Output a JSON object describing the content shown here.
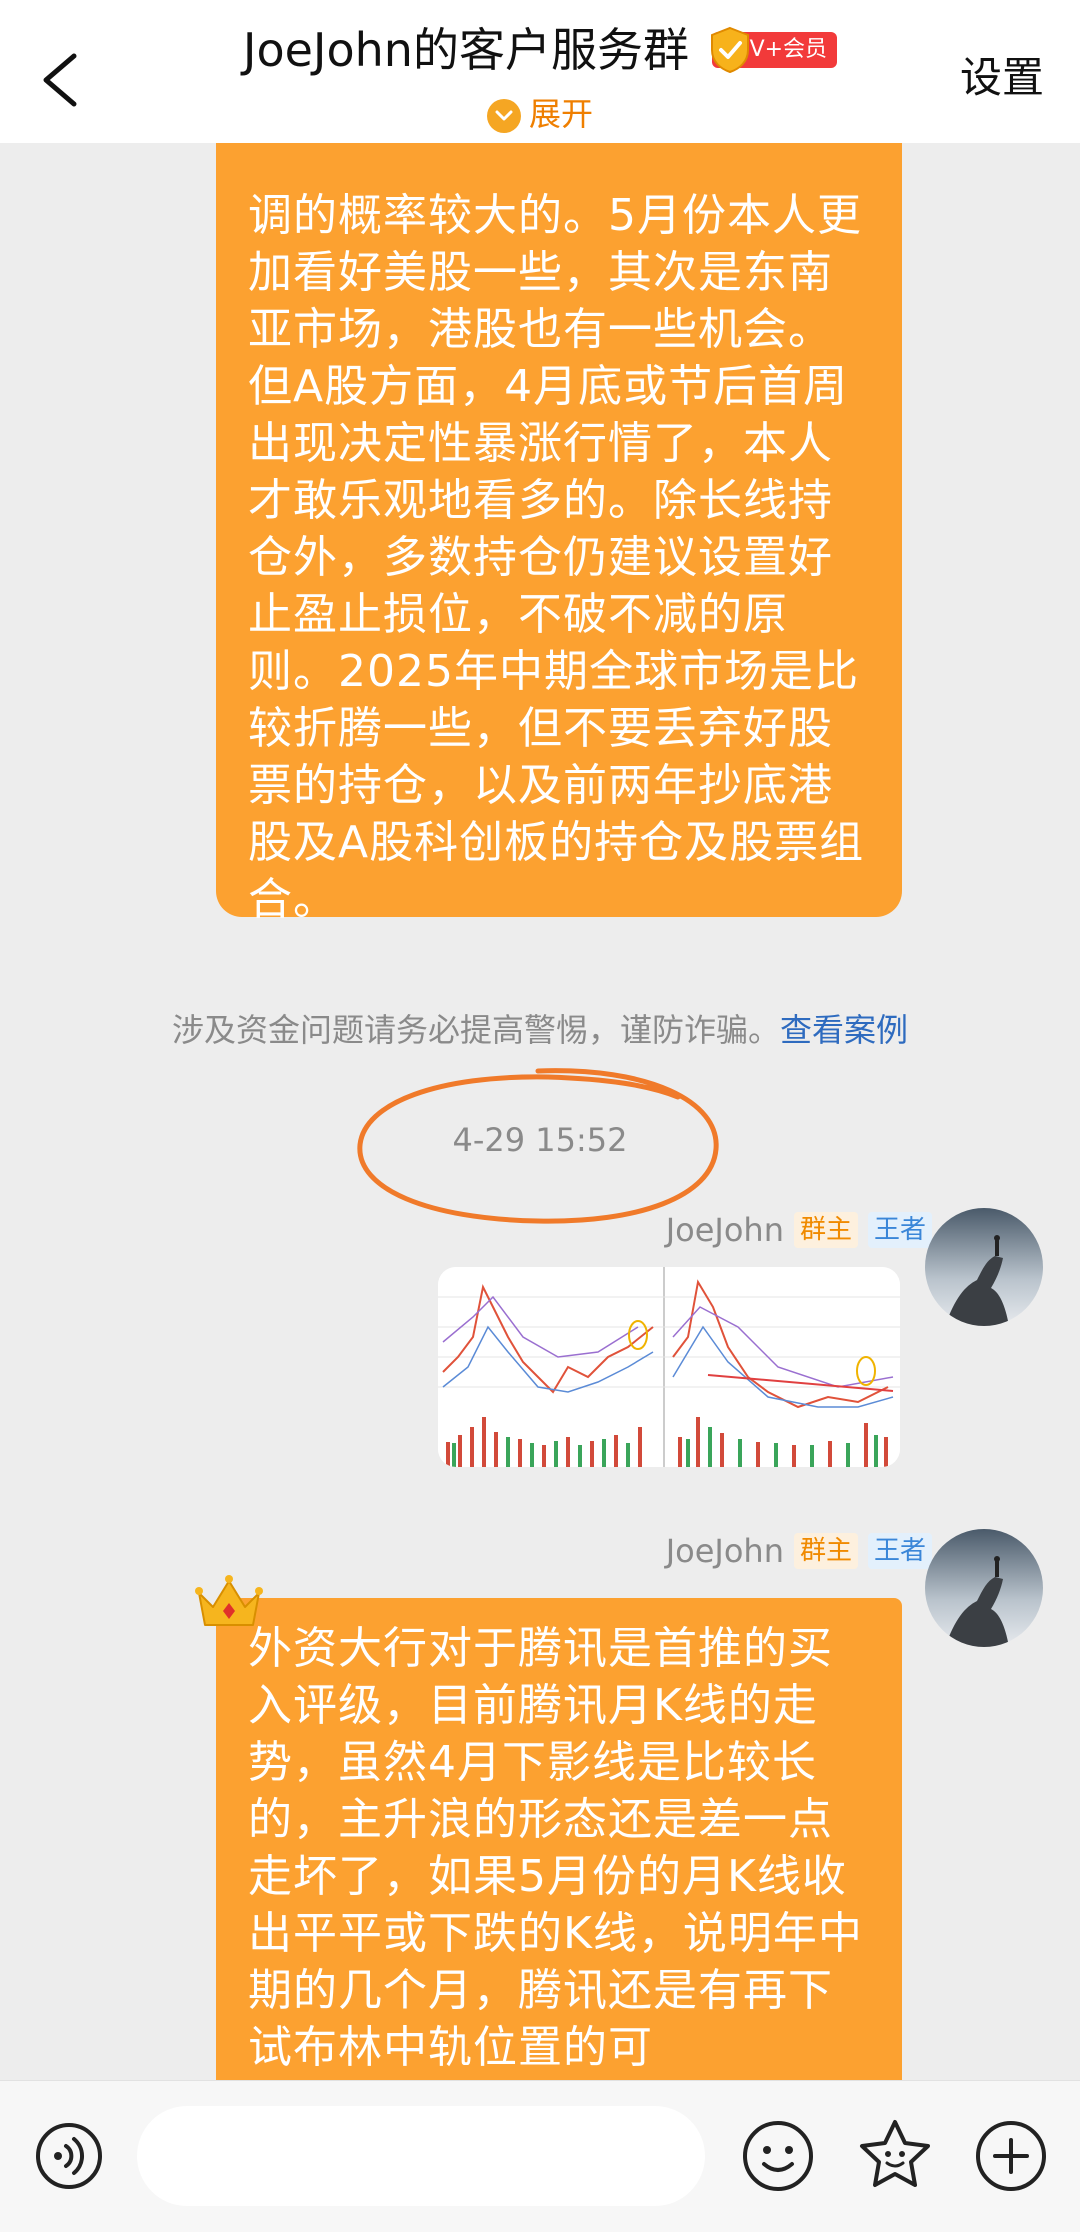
{
  "header": {
    "title": "JoeJohn的客户服务群",
    "vip_label": "V+会员",
    "expand_label": "展开",
    "settings_label": "设置"
  },
  "messages": {
    "msg1_text": "调的概率较大的。5月份本人更加看好美股一些，其次是东南亚市场，港股也有一些机会。但A股方面，4月底或节后首周出现决定性暴涨行情了，本人才敢乐观地看多的。除长线持仓外，多数持仓仍建议设置好止盈止损位，不破不减的原则。2025年中期全球市场是比较折腾一些，但不要丢弃好股票的持仓，以及前两年抄底港股及A股科创板的持仓及股票组合。",
    "notice_text": "涉及资金问题请务必提高警惕，谨防诈骗。",
    "notice_link": "查看案例",
    "timestamp": "4-29 15:52",
    "sender_name_1": "JoeJohn",
    "sender_name_2": "JoeJohn",
    "tag_owner": "群主",
    "tag_king": "王者",
    "msg2_text": "外资大行对于腾讯是首推的买入评级，目前腾讯月K线的走势，虽然4月下影线是比较长的，主升浪的形态还是差一点走坏了，如果5月份的月K线收出平平或下跌的K线，说明年中期的几个月，腾讯还是有再下试布林中轨位置的可"
  },
  "input": {
    "placeholder": ""
  },
  "colors": {
    "bubble": "#fca130",
    "accent": "#ef7f00",
    "link": "#2e6bbf",
    "vip": "#f23a3a"
  },
  "icons": [
    "back-arrow-icon",
    "vip-shield-icon",
    "expand-chevron-icon",
    "voice-icon",
    "emoji-icon",
    "sticker-icon",
    "plus-icon",
    "crown-icon"
  ]
}
